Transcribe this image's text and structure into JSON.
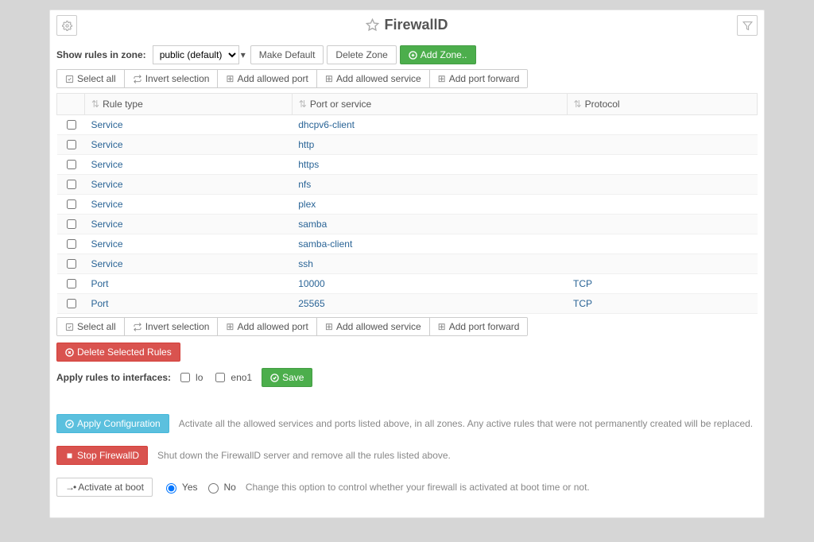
{
  "header": {
    "title": "FirewallD"
  },
  "zonebar": {
    "label": "Show rules in zone:",
    "zone_selected": "public (default)",
    "make_default": "Make Default",
    "delete_zone": "Delete Zone",
    "add_zone": "Add Zone.."
  },
  "toolbar": {
    "select_all": "Select all",
    "invert": "Invert selection",
    "add_port": "Add allowed port",
    "add_service": "Add allowed service",
    "add_forward": "Add port forward"
  },
  "table": {
    "cols": {
      "type": "Rule type",
      "port": "Port or service",
      "proto": "Protocol"
    },
    "rows": [
      {
        "type": "Service",
        "port": "dhcpv6-client",
        "proto": ""
      },
      {
        "type": "Service",
        "port": "http",
        "proto": ""
      },
      {
        "type": "Service",
        "port": "https",
        "proto": ""
      },
      {
        "type": "Service",
        "port": "nfs",
        "proto": ""
      },
      {
        "type": "Service",
        "port": "plex",
        "proto": ""
      },
      {
        "type": "Service",
        "port": "samba",
        "proto": ""
      },
      {
        "type": "Service",
        "port": "samba-client",
        "proto": ""
      },
      {
        "type": "Service",
        "port": "ssh",
        "proto": ""
      },
      {
        "type": "Port",
        "port": "10000",
        "proto": "TCP"
      },
      {
        "type": "Port",
        "port": "25565",
        "proto": "TCP"
      }
    ]
  },
  "actions": {
    "delete_selected": "Delete Selected Rules",
    "apply_ifaces_label": "Apply rules to interfaces:",
    "iface1": "lo",
    "iface2": "eno1",
    "save": "Save"
  },
  "apply_conf": {
    "button": "Apply Configuration",
    "hint": "Activate all the allowed services and ports listed above, in all zones. Any active rules that were not permanently created will be replaced."
  },
  "stop": {
    "button": "Stop FirewallD",
    "hint": "Shut down the FirewallD server and remove all the rules listed above."
  },
  "boot": {
    "button": "Activate at boot",
    "yes": "Yes",
    "no": "No",
    "hint": "Change this option to control whether your firewall is activated at boot time or not."
  }
}
